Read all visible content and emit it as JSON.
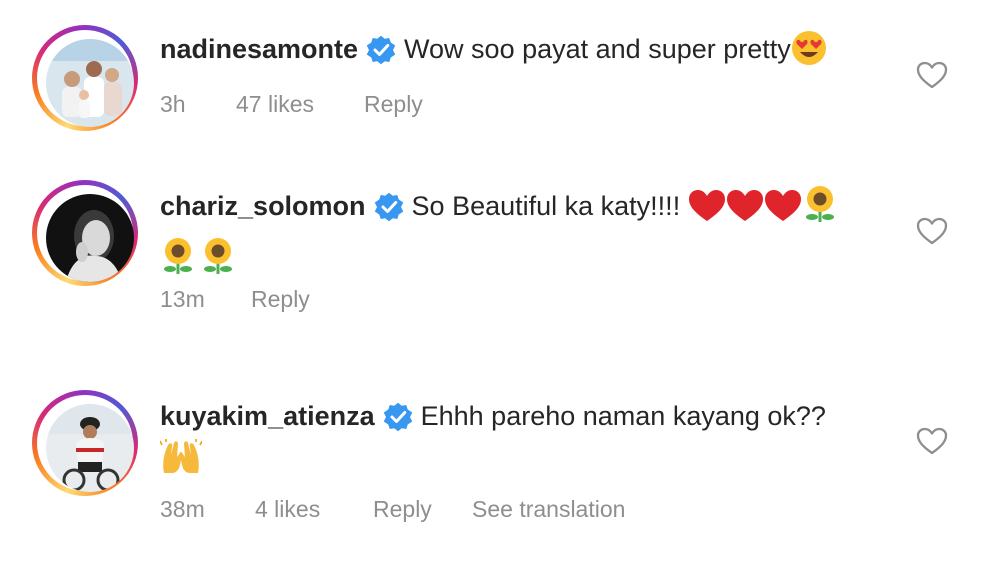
{
  "comments": [
    {
      "username": "nadinesamonte",
      "message": "Wow soo payat and super pretty",
      "time": "3h",
      "likes": "47 likes",
      "reply": "Reply"
    },
    {
      "username": "chariz_solomon",
      "message": "So Beautiful ka katy!!!!",
      "time": "13m",
      "reply": "Reply"
    },
    {
      "username": "kuyakim_atienza",
      "message": "Ehhh pareho naman kayang ok??",
      "time": "38m",
      "likes": "4 likes",
      "reply": "Reply",
      "translation": "See translation"
    }
  ],
  "icons": {
    "verified": "verified-badge-icon",
    "like": "heart-outline-icon"
  },
  "colors": {
    "verified_blue": "#3897f0",
    "meta_gray": "#8e8e8e",
    "text": "#262626"
  }
}
